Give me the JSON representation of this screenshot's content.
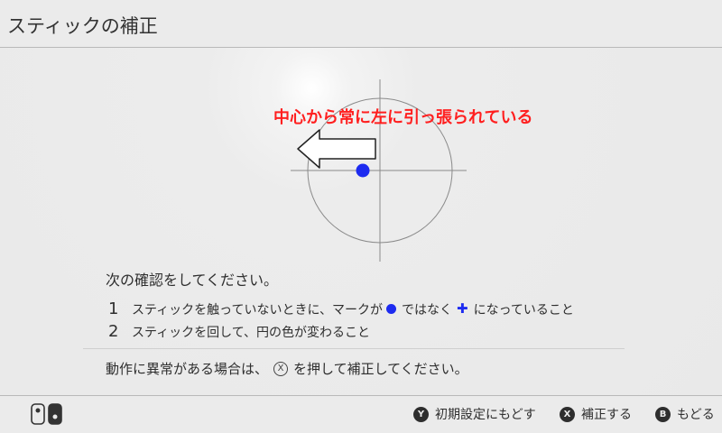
{
  "header": {
    "title": "スティックの補正"
  },
  "annotation": {
    "text": "中心から常に左に引っ張られている"
  },
  "instructions": {
    "title": "次の確認をしてください。",
    "step1": {
      "number": "1",
      "text_before": "スティックを触っていないときに、マークが",
      "text_middle": "ではなく",
      "text_after": "になっていること"
    },
    "step2": {
      "number": "2",
      "text": "スティックを回して、円の色が変わること"
    },
    "notice_before": "動作に異常がある場合は、",
    "notice_button": "X",
    "notice_after": "を押して補正してください。"
  },
  "footer": {
    "reset": {
      "button": "Y",
      "label": "初期設定にもどす"
    },
    "calibrate": {
      "button": "X",
      "label": "補正する"
    },
    "back": {
      "button": "B",
      "label": "もどる"
    }
  },
  "colors": {
    "annotation": "#ff1f1f",
    "stick_marker": "#1d2bf0",
    "background": "#ebebeb"
  }
}
